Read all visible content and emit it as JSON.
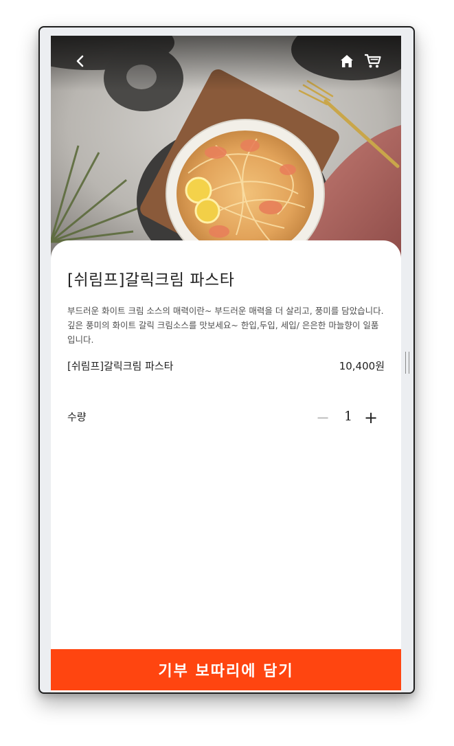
{
  "header": {
    "back_icon": "chevron-left-icon",
    "home_icon": "home-icon",
    "cart_icon": "cart-icon"
  },
  "product": {
    "title": "[쉬림프]갈릭크림 파스타",
    "description": "부드러운 화이트 크림 소스의 매력이란~ 부드러운 매력을 더 살리고, 풍미를 담았습니다. 깊은 풍미의 화이트 갈릭 크림소스를 맛보세요~ 한입,두입, 세입/ 은은한 마늘향이 일품입니다.",
    "option_name": "[쉬림프]갈릭크림 파스타",
    "option_price": "10,400원"
  },
  "quantity": {
    "label": "수량",
    "value": "1",
    "minus_symbol": "−",
    "plus_symbol": "+"
  },
  "cta": {
    "label": "기부 보따리에 담기",
    "color": "#ff4510"
  }
}
